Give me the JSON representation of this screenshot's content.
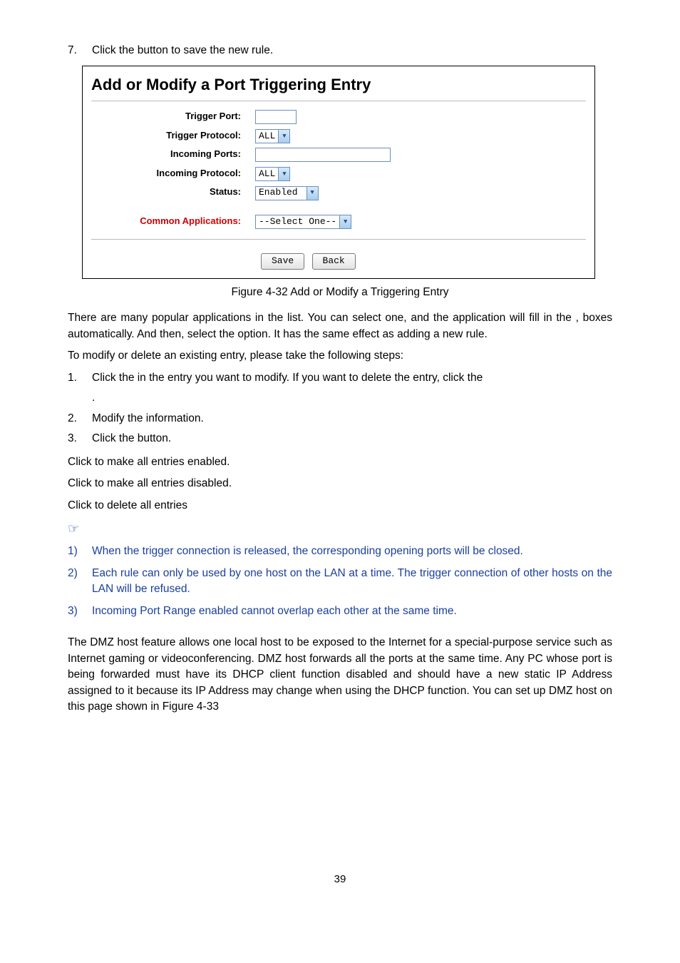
{
  "step7": {
    "num": "7.",
    "text_before": "Click the ",
    "text_after": " button to save the new rule."
  },
  "dialog": {
    "title": "Add or Modify a Port Triggering Entry",
    "labels": {
      "trigger_port": "Trigger Port:",
      "trigger_protocol": "Trigger Protocol:",
      "incoming_ports": "Incoming Ports:",
      "incoming_protocol": "Incoming Protocol:",
      "status": "Status:",
      "common_apps": "Common Applications:"
    },
    "values": {
      "trigger_port": "",
      "trigger_protocol": "ALL",
      "incoming_ports": "",
      "incoming_protocol": "ALL",
      "status": "Enabled",
      "common_apps": "--Select One--"
    },
    "buttons": {
      "save": "Save",
      "back": "Back"
    }
  },
  "caption": "Figure 4-32 Add or Modify a Triggering Entry",
  "para_popular": "There are many popular applications in the                                                      list. You can select one, and the application will fill in the                                           ,                                                           boxes automatically. And then, select the                option. It has the same effect as adding a new rule.",
  "para_modify": "To modify or delete an existing entry, please take the following steps:",
  "mod_steps": {
    "s1_num": "1.",
    "s1": "Click the                 in the entry you want to modify. If you want to delete the entry, click the",
    "s1_cont": ".",
    "s2_num": "2.",
    "s2": "Modify the information.",
    "s3_num": "3.",
    "s3": "Click the            button."
  },
  "click_lines": {
    "c1": "Click                    to make all entries enabled.",
    "c2": "Click                       to make all entries disabled.",
    "c3": "Click                   to delete all entries"
  },
  "note_symbol": "☞",
  "notes": {
    "n1_num": "1)",
    "n1": "When the trigger connection is released, the corresponding opening ports will be closed.",
    "n2_num": "2)",
    "n2": "Each rule can only be used by one host on the LAN at a time. The trigger connection of other hosts on the LAN will be refused.",
    "n3_num": "3)",
    "n3": "Incoming Port Range enabled cannot overlap each other at the same time."
  },
  "dmz": "The DMZ host feature allows one local host to be exposed to the Internet for a special-purpose service such as Internet gaming or videoconferencing. DMZ host forwards all the ports at the same time. Any PC whose port is being forwarded must have its DHCP client function disabled and should have a new static IP Address assigned to it because its IP Address may change when using the DHCP function. You can set up DMZ host on this page shown in Figure 4-33",
  "page_number": "39"
}
